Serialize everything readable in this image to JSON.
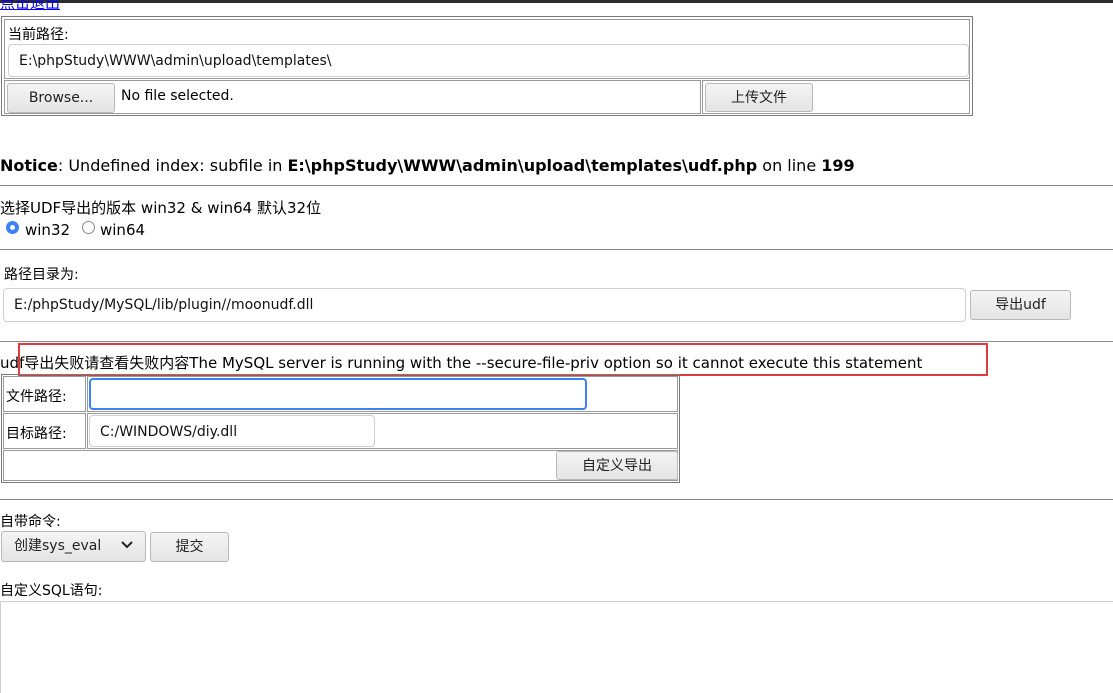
{
  "header": {
    "logout_link": "点击退出"
  },
  "upload": {
    "current_path_label": "当前路径:",
    "current_path_value": "E:\\phpStudy\\WWW\\admin\\upload\\templates\\",
    "browse_button": "Browse...",
    "file_status": "No file selected.",
    "upload_button": "上传文件"
  },
  "notice": {
    "label": "Notice",
    "message": ": Undefined index: subfile in ",
    "path": "E:\\phpStudy\\WWW\\admin\\upload\\templates\\udf.php",
    "on_line": " on line ",
    "line": "199"
  },
  "udf_version": {
    "prompt": "选择UDF导出的版本 win32 & win64 默认32位",
    "options": [
      "win32",
      "win64"
    ],
    "selected": "win32"
  },
  "export": {
    "dir_label": "路径目录为:",
    "dir_value": "E:/phpStudy/MySQL/lib/plugin//moonudf.dll",
    "export_button": "导出udf"
  },
  "error": {
    "message": "udf导出失败请查看失败内容The MySQL server is running with the --secure-file-priv option so it cannot execute this statement",
    "highlight_color": "#e0393e"
  },
  "custom_export": {
    "file_path_label": "文件路径:",
    "file_path_value": "",
    "target_path_label": "目标路径:",
    "target_path_value": "C:/WINDOWS/diy.dll",
    "button": "自定义导出"
  },
  "command": {
    "label": "自带命令:",
    "selected": "创建sys_eval",
    "submit_button": "提交"
  },
  "sql": {
    "label": "自定义SQL语句:",
    "value": ""
  }
}
